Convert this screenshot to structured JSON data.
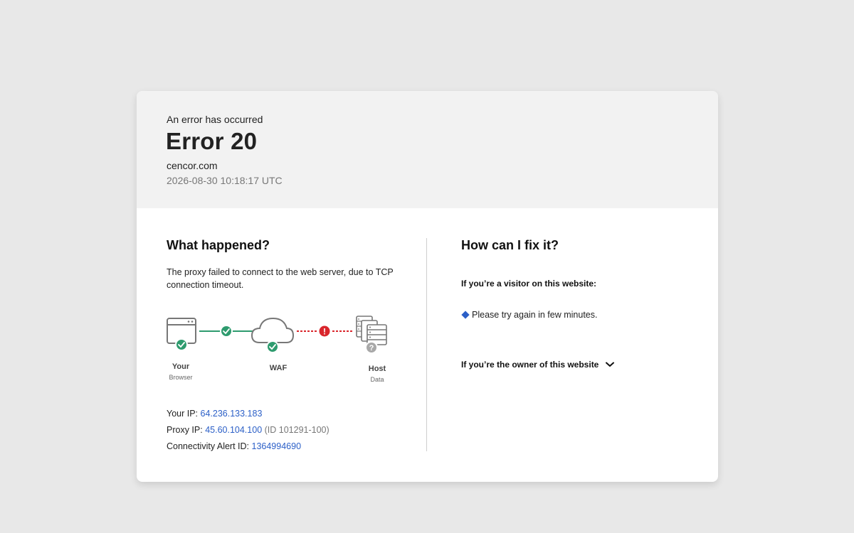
{
  "header": {
    "eyebrow": "An error has occurred",
    "title": "Error 20",
    "domain": "cencor.com",
    "timestamp": "2026-08-30 10:18:17 UTC"
  },
  "what_happened": {
    "title": "What happened?",
    "description": "The proxy failed to connect to the web server, due to TCP connection timeout.",
    "nodes": [
      {
        "label": "Your",
        "sub": "Browser",
        "status": "ok",
        "icon": "browser-icon"
      },
      {
        "label": "WAF",
        "sub": "",
        "status": "ok",
        "icon": "cloud-icon"
      },
      {
        "label": "Host",
        "sub": "Data",
        "status": "unknown",
        "icon": "server-icon"
      }
    ],
    "links": [
      {
        "status": "ok",
        "color": "#2e9b6e"
      },
      {
        "status": "error",
        "color": "#d9262c"
      }
    ]
  },
  "info": {
    "your_ip_label": "Your IP:",
    "your_ip": "64.236.133.183",
    "proxy_ip_label": "Proxy IP:",
    "proxy_ip": "45.60.104.100",
    "proxy_id": "(ID 101291-100)",
    "alert_label": "Connectivity Alert ID:",
    "alert_id": "1364994690"
  },
  "fix": {
    "title": "How can I fix it?",
    "visitor_label": "If you’re a visitor on this website:",
    "visitor_tip": "Please try again in few minutes.",
    "owner_label": "If you’re the owner of this website"
  },
  "colors": {
    "ok": "#2e9b6e",
    "error": "#d9262c",
    "unknown": "#a8a8a8",
    "link": "#2b5fc7"
  }
}
